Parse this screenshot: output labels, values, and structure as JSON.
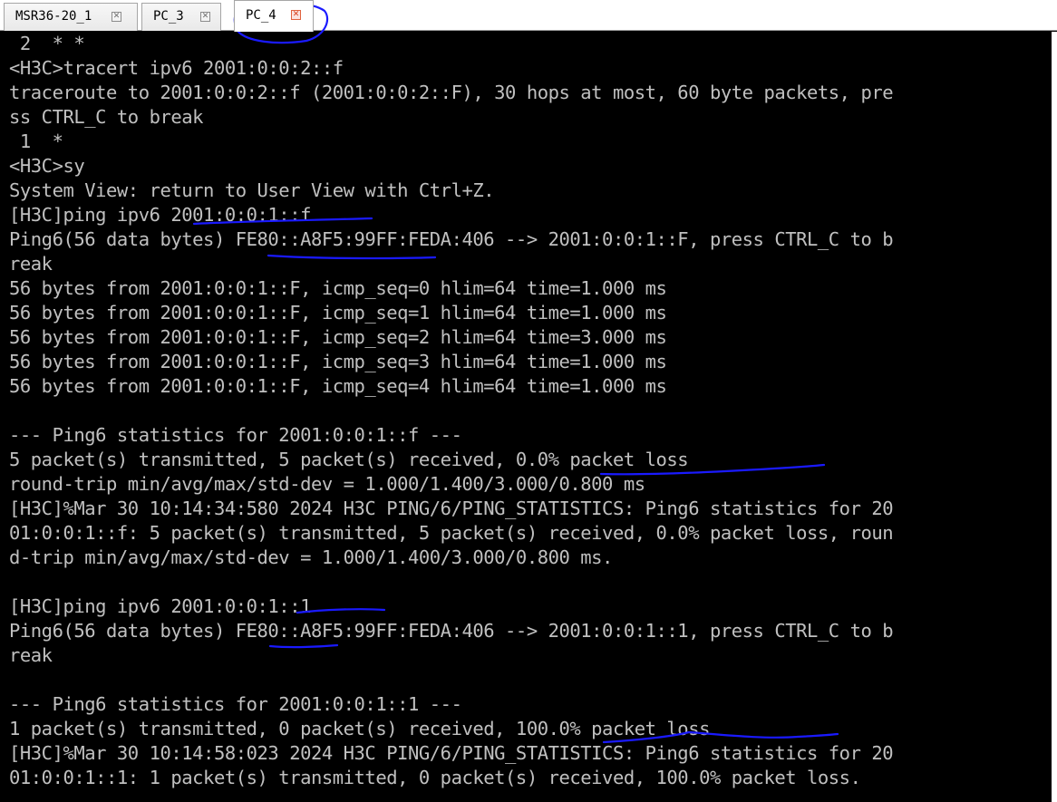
{
  "tabs": [
    {
      "label": "MSR36-20_1"
    },
    {
      "label": "PC_3"
    },
    {
      "label": "PC_4"
    }
  ],
  "terminal": {
    "lines": [
      " 2  * *",
      "<H3C>tracert ipv6 2001:0:0:2::f",
      "traceroute to 2001:0:0:2::f (2001:0:0:2::F), 30 hops at most, 60 byte packets, pre",
      "ss CTRL_C to break",
      " 1  *",
      "<H3C>sy",
      "System View: return to User View with Ctrl+Z.",
      "[H3C]ping ipv6 2001:0:0:1::f",
      "Ping6(56 data bytes) FE80::A8F5:99FF:FEDA:406 --> 2001:0:0:1::F, press CTRL_C to b",
      "reak",
      "56 bytes from 2001:0:0:1::F, icmp_seq=0 hlim=64 time=1.000 ms",
      "56 bytes from 2001:0:0:1::F, icmp_seq=1 hlim=64 time=1.000 ms",
      "56 bytes from 2001:0:0:1::F, icmp_seq=2 hlim=64 time=3.000 ms",
      "56 bytes from 2001:0:0:1::F, icmp_seq=3 hlim=64 time=1.000 ms",
      "56 bytes from 2001:0:0:1::F, icmp_seq=4 hlim=64 time=1.000 ms",
      "",
      "--- Ping6 statistics for 2001:0:0:1::f ---",
      "5 packet(s) transmitted, 5 packet(s) received, 0.0% packet loss",
      "round-trip min/avg/max/std-dev = 1.000/1.400/3.000/0.800 ms",
      "[H3C]%Mar 30 10:14:34:580 2024 H3C PING/6/PING_STATISTICS: Ping6 statistics for 20",
      "01:0:0:1::f: 5 packet(s) transmitted, 5 packet(s) received, 0.0% packet loss, roun",
      "d-trip min/avg/max/std-dev = 1.000/1.400/3.000/0.800 ms.",
      "",
      "[H3C]ping ipv6 2001:0:0:1::1",
      "Ping6(56 data bytes) FE80::A8F5:99FF:FEDA:406 --> 2001:0:0:1::1, press CTRL_C to b",
      "reak",
      "",
      "--- Ping6 statistics for 2001:0:0:1::1 ---",
      "1 packet(s) transmitted, 0 packet(s) received, 100.0% packet loss",
      "[H3C]%Mar 30 10:14:58:023 2024 H3C PING/6/PING_STATISTICS: Ping6 statistics for 20",
      "01:0:0:1::1: 1 packet(s) transmitted, 0 packet(s) received, 100.0% packet loss."
    ]
  },
  "colors": {
    "terminal_background": "#000000",
    "terminal_text": "#c0c0c0",
    "annotation_ink": "#1a1aff",
    "close_icon_active": "#d8401b"
  }
}
